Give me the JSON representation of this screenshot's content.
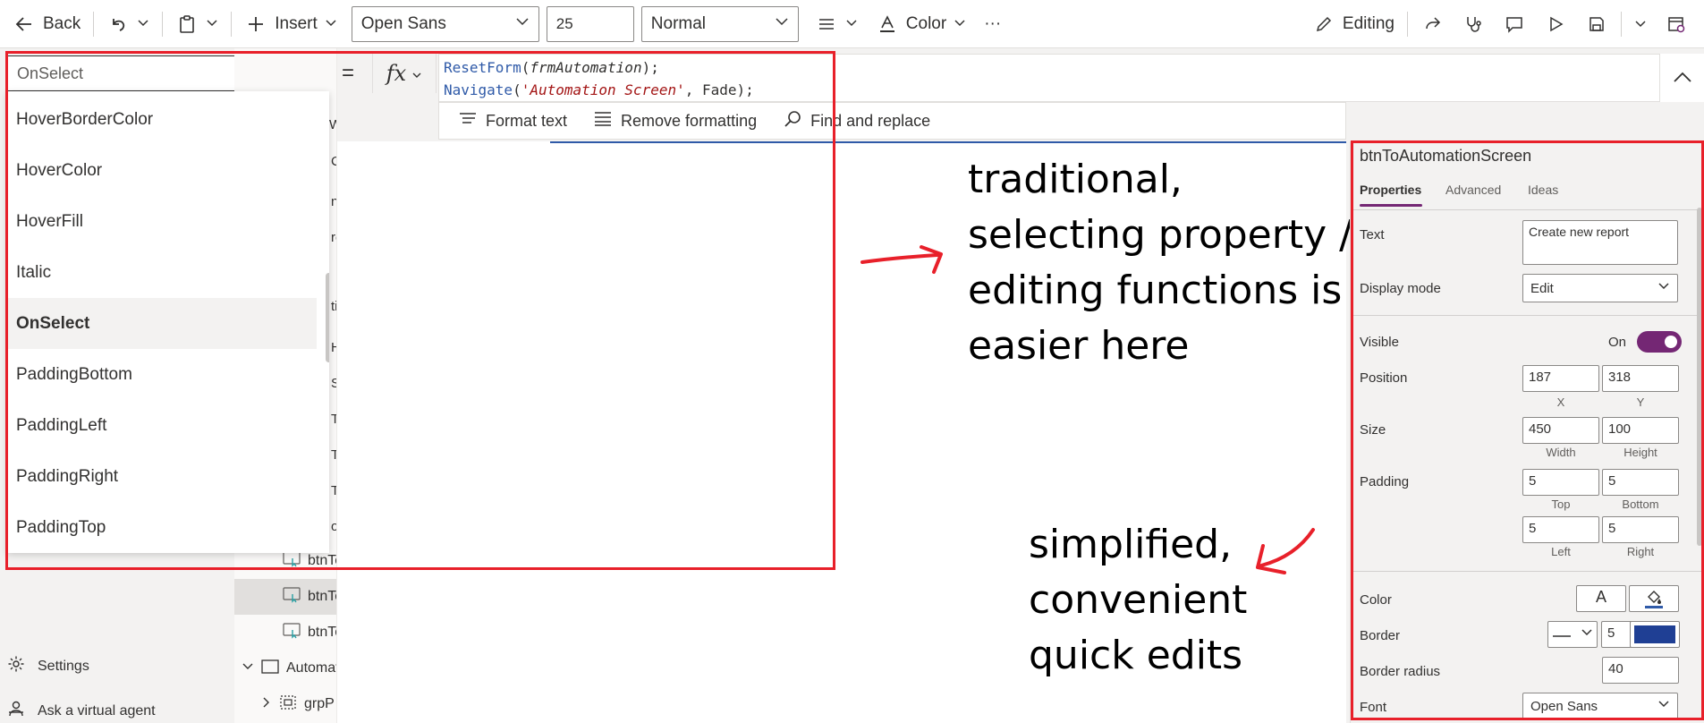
{
  "toolbar": {
    "back_label": "Back",
    "insert_label": "Insert",
    "font_value": "Open Sans",
    "size_value": "25",
    "weight_value": "Normal",
    "color_label": "Color",
    "more_label": "···",
    "editing_label": "Editing"
  },
  "formula": {
    "property_value": "OnSelect",
    "equals": "=",
    "fx_label": "fx",
    "line1_fn": "ResetForm",
    "line1_open": "(",
    "line1_arg": "frmAutomation",
    "line1_close": ");",
    "line2_fn": "Navigate",
    "line2_open": "(",
    "line2_str": "'Automation Screen'",
    "line2_rest": ", Fade);",
    "format_text": "Format text",
    "remove_formatting": "Remove formatting",
    "find_replace": "Find and replace"
  },
  "dropdown": {
    "items": [
      "HoverBorderColor",
      "HoverColor",
      "HoverFill",
      "Italic",
      "OnSelect",
      "PaddingBottom",
      "PaddingLeft",
      "PaddingRight",
      "PaddingTop"
    ],
    "active": "OnSelect"
  },
  "tree": {
    "rows": [
      {
        "label": "btnTo"
      },
      {
        "label": "btnTo"
      },
      {
        "label": "btnTo"
      },
      {
        "label": "Automat"
      },
      {
        "label": "grpP"
      }
    ],
    "fragments": [
      "W",
      "C",
      "n",
      "re",
      "ti",
      "H",
      "S",
      "Tc",
      "Tc",
      "Tc",
      "o"
    ]
  },
  "nav": {
    "settings": "Settings",
    "virtual_agent": "Ask a virtual agent"
  },
  "notes": {
    "top": "traditional,\nselecting property /\nediting functions is\neasier here",
    "bottom": "simplified,\nconvenient\nquick edits"
  },
  "panel": {
    "control_name": "btnToAutomationScreen",
    "tabs": [
      "Properties",
      "Advanced",
      "Ideas"
    ],
    "text_label": "Text",
    "text_value": "Create new report",
    "display_mode_label": "Display mode",
    "display_mode_value": "Edit",
    "visible_label": "Visible",
    "visible_value": "On",
    "position_label": "Position",
    "position_x": "187",
    "position_y": "318",
    "x_label": "X",
    "y_label": "Y",
    "size_label": "Size",
    "width_value": "450",
    "height_value": "100",
    "width_label": "Width",
    "height_label": "Height",
    "padding_label": "Padding",
    "padding_top": "5",
    "padding_bottom": "5",
    "padding_left": "5",
    "padding_right": "5",
    "top_label": "Top",
    "bottom_label": "Bottom",
    "left_label": "Left",
    "right_label": "Right",
    "color_label": "Color",
    "color_text_glyph": "A",
    "border_label": "Border",
    "border_width": "5",
    "border_color": "#1f3f94",
    "border_radius_label": "Border radius",
    "border_radius_value": "40",
    "font_label": "Font",
    "font_value": "Open Sans"
  },
  "colors": {
    "accent": "#742774",
    "annotation_red": "#e8202a",
    "code_blue": "#2f5aa8"
  }
}
